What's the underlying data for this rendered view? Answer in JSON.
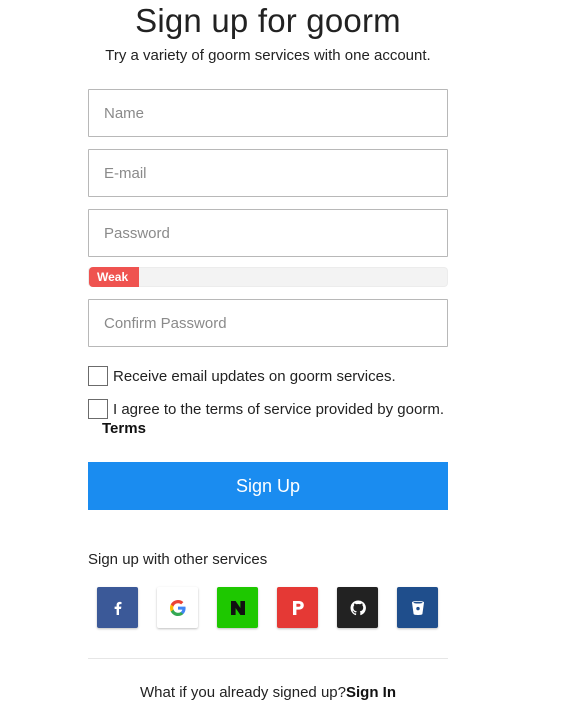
{
  "header": {
    "title": "Sign up for goorm",
    "subtitle": "Try a variety of goorm services with one account."
  },
  "form": {
    "name_placeholder": "Name",
    "email_placeholder": "E-mail",
    "password_placeholder": "Password",
    "confirm_placeholder": "Confirm Password",
    "strength": {
      "label": "Weak",
      "level": 0.14,
      "color": "#ef5350"
    },
    "updates_label": "Receive email updates on goorm services.",
    "terms_label": "I agree to the terms of service provided by goorm.",
    "terms_link": "Terms",
    "submit_label": "Sign Up"
  },
  "social": {
    "heading": "Sign up with other services",
    "providers": [
      {
        "icon": "facebook-icon",
        "color": "#3b5998"
      },
      {
        "icon": "google-icon",
        "color": "#ffffff"
      },
      {
        "icon": "naver-icon",
        "color": "#1ec800"
      },
      {
        "icon": "pinterest-icon",
        "color": "#e53935"
      },
      {
        "icon": "github-icon",
        "color": "#222222"
      },
      {
        "icon": "bitbucket-icon",
        "color": "#1f4e8c"
      }
    ]
  },
  "footer": {
    "prompt": "What if you already signed up?",
    "signin_link": "Sign In"
  }
}
